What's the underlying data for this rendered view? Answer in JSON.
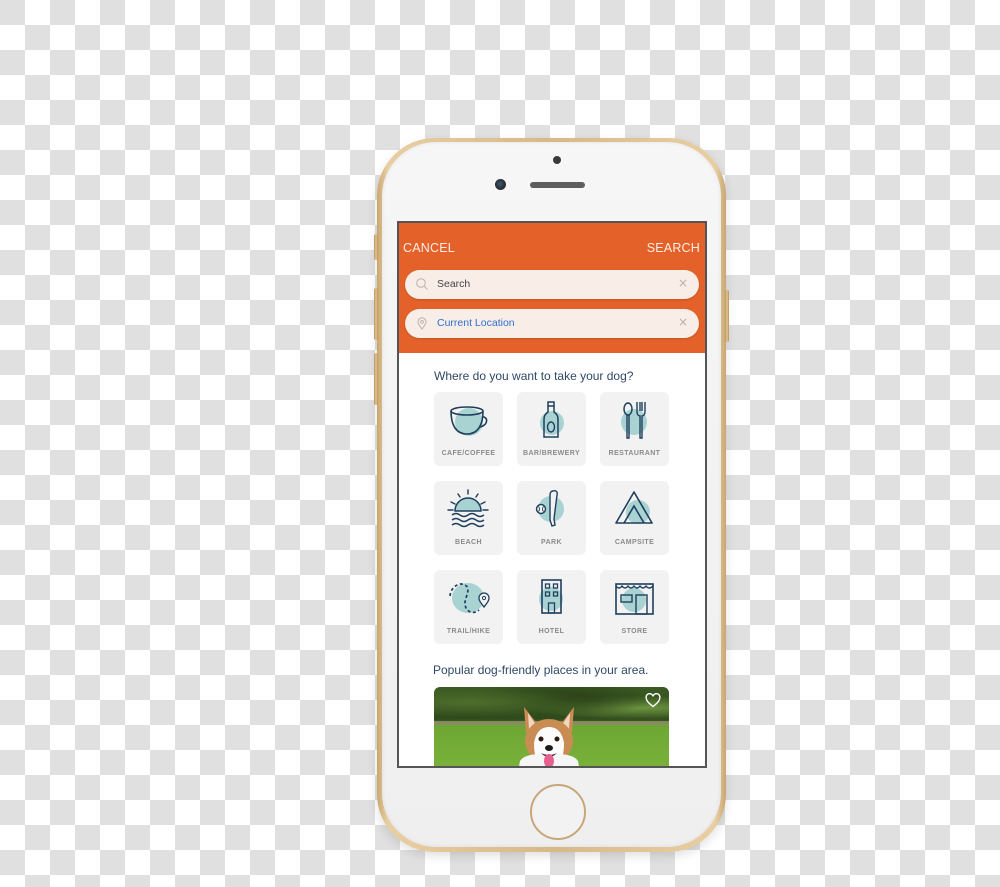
{
  "background": "transparency-checkerboard",
  "device": {
    "model": "smartphone",
    "frame_color": "#d8b887",
    "face_color": "#f2f2f2"
  },
  "header": {
    "cancel_label": "CANCEL",
    "search_label": "SEARCH",
    "color": "#e4622a"
  },
  "search_field": {
    "icon": "search-icon",
    "placeholder": "Search",
    "value": "",
    "clear_icon": "×"
  },
  "location_field": {
    "icon": "location-pin-icon",
    "value": "Current Location",
    "clear_icon": "×"
  },
  "categories_heading": "Where do you want to take your dog?",
  "categories": [
    {
      "label": "CAFE/COFFEE",
      "icon": "coffee-cup-icon"
    },
    {
      "label": "BAR/BREWERY",
      "icon": "bottle-icon"
    },
    {
      "label": "RESTAURANT",
      "icon": "spoon-fork-icon"
    },
    {
      "label": "BEACH",
      "icon": "sunset-waves-icon"
    },
    {
      "label": "PARK",
      "icon": "baseball-bat-icon"
    },
    {
      "label": "CAMPSITE",
      "icon": "tent-icon"
    },
    {
      "label": "TRAIL/HIKE",
      "icon": "trail-map-icon"
    },
    {
      "label": "HOTEL",
      "icon": "hotel-building-icon"
    },
    {
      "label": "STORE",
      "icon": "storefront-icon"
    }
  ],
  "popular_heading": "Popular dog-friendly places in your area.",
  "popular_cards": [
    {
      "image": "corgi-on-grass-photo",
      "favorite_icon": "heart-outline-icon",
      "favorited": false
    }
  ],
  "colors": {
    "icon_stroke": "#1f3f5c",
    "icon_fill": "#a9d3d3",
    "heading_text": "#2e4966",
    "location_text": "#2f6fd0"
  }
}
